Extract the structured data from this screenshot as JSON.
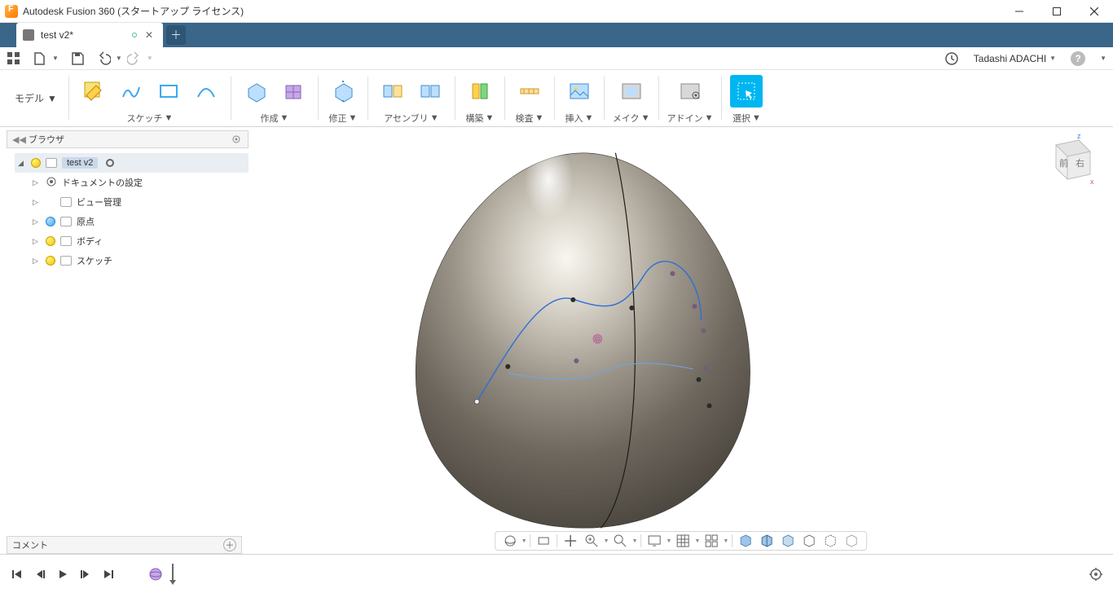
{
  "title": "Autodesk Fusion 360 (スタートアップ ライセンス)",
  "tab": {
    "label": "test v2*"
  },
  "qat": {
    "user": "Tadashi ADACHI"
  },
  "workspace": {
    "label": "モデル"
  },
  "ribbon": {
    "sketch": "スケッチ",
    "create": "作成",
    "modify": "修正",
    "assemble": "アセンブリ",
    "construct": "構築",
    "inspect": "検査",
    "insert": "挿入",
    "make": "メイク",
    "addins": "アドイン",
    "select": "選択"
  },
  "panels": {
    "browser": "ブラウザ",
    "comments": "コメント"
  },
  "tree": {
    "root": "test v2",
    "docset": "ドキュメントの設定",
    "views": "ビュー管理",
    "origin": "原点",
    "bodies": "ボディ",
    "sketches": "スケッチ"
  },
  "viewcube": {
    "front": "前",
    "right": "右",
    "z": "z",
    "x": "x"
  }
}
